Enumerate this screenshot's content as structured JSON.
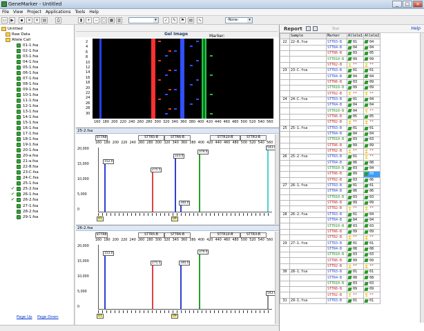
{
  "window": {
    "title": "GeneMarker - Untitled"
  },
  "menu": [
    "File",
    "View",
    "Project",
    "Applications",
    "Tools",
    "Help"
  ],
  "toolbar": {
    "marker_label": "Marker:",
    "marker_value": "-None-"
  },
  "tree": {
    "root": "Untitled",
    "raw": "Raw Data",
    "call": "Allele Call",
    "files": [
      "01-1.fsa",
      "02-1.fsa",
      "03-1.fsa",
      "04-1.fsa",
      "05-1.fsa",
      "06-1.fsa",
      "07-1.fsa",
      "08-1.fsa",
      "09-1.fsa",
      "10-1.fsa",
      "11-1.fsa",
      "12-1.fsa",
      "13-1.fsa",
      "14-1.fsa",
      "15-1.fsa",
      "16-1.fsa",
      "17-1.fsa",
      "18-1.fsa",
      "19-1.fsa",
      "20-1.fsa",
      "20-a.fsa",
      "21-a.fsa",
      "22-8.fsa",
      "23-C.fsa",
      "24-C.fsa",
      "25-1.fsa",
      "25-2.fsa",
      "26-1.fsa",
      "26-2.fsa",
      "27-1.fsa",
      "28-2.fsa",
      "29-1.fsa"
    ],
    "checked": [
      "25-2.fsa",
      "26-1.fsa",
      "26-2.fsa"
    ]
  },
  "left_footer": {
    "page_up": "Page Up",
    "page_down": "Page Down"
  },
  "gel": {
    "title": "Gel Image",
    "y_ticks": [
      "2",
      "4",
      "6",
      "8",
      "10",
      "12",
      "14",
      "16",
      "18",
      "20",
      "22",
      "24",
      "26",
      "28",
      "30"
    ],
    "x_ticks": [
      "160",
      "180",
      "200",
      "220",
      "240",
      "260",
      "280",
      "300",
      "320",
      "340",
      "360",
      "380",
      "400",
      "420",
      "440",
      "460",
      "480",
      "500",
      "520",
      "540",
      "560"
    ]
  },
  "panel1": {
    "name": "25-2.fsa",
    "loci": [
      "STTR8",
      "STTR5-B",
      "STTR6-B",
      "STTR10-B",
      "STTR3-B"
    ],
    "x_ticks": [
      "160",
      "180",
      "200",
      "220",
      "240",
      "260",
      "280",
      "300",
      "320",
      "340",
      "360",
      "380",
      "400",
      "420",
      "440",
      "460",
      "480",
      "500",
      "520",
      "540",
      "560"
    ],
    "y_ticks": [
      "20,000",
      "15,000",
      "10,000",
      "5,000",
      "0"
    ],
    "peaks": [
      "152.0",
      "275.5",
      "333.0",
      "340.0",
      "379.0",
      "543.0"
    ],
    "markers": [
      "01",
      "09"
    ]
  },
  "panel2": {
    "name": "26-2.fsa",
    "loci": [
      "STTR8",
      "STTR5-B",
      "STTR6-B",
      "STTR10-B",
      "STTR3-B"
    ],
    "x_ticks": [
      "160",
      "180",
      "200",
      "220",
      "240",
      "260",
      "280",
      "300",
      "320",
      "340",
      "360",
      "380",
      "400",
      "420",
      "440",
      "460",
      "480",
      "500",
      "520",
      "540",
      "560"
    ],
    "y_ticks": [
      "20,000",
      "15,000",
      "10,000",
      "5,000",
      "0"
    ],
    "peaks": [
      "153.0",
      "275.5",
      "340.0",
      "379.0",
      "543.0"
    ],
    "markers": [
      "01",
      "09"
    ]
  },
  "report": {
    "title": "Report",
    "filter_label": "Stat",
    "help": "Help",
    "columns": [
      "",
      "Sample",
      "Marker",
      "Allele1",
      "Allele2"
    ],
    "rows": [
      [
        "22",
        "22-8.fsa",
        "STTR3-B",
        "01",
        "04"
      ],
      [
        "",
        "",
        "STTR4-B",
        "04",
        "04"
      ],
      [
        "",
        "",
        "STTR6-B",
        "03",
        "05"
      ],
      [
        "",
        "",
        "STTR10-B",
        "09",
        "09"
      ],
      [
        "",
        "",
        "STTR2-B",
        "**",
        "**"
      ],
      [
        "23",
        "23-C.fsa",
        "STTR3-B",
        "01",
        "01"
      ],
      [
        "",
        "",
        "STTR4-B",
        "04",
        "04"
      ],
      [
        "",
        "",
        "STTR6-B",
        "03",
        "09"
      ],
      [
        "",
        "",
        "STTR10-B",
        "09",
        "09"
      ],
      [
        "",
        "",
        "STTR2-B",
        "**",
        "**"
      ],
      [
        "24",
        "24-C.fsa",
        "STTR3-B",
        "01",
        "04"
      ],
      [
        "",
        "",
        "STTR4-B",
        "04",
        "04"
      ],
      [
        "",
        "",
        "STTR10-B",
        "04",
        "**"
      ],
      [
        "",
        "",
        "STTR6-B",
        "05",
        "05"
      ],
      [
        "",
        "",
        "STTR2-B",
        "**",
        "**"
      ],
      [
        "25",
        "25-1.fsa",
        "STTR3-B",
        "01",
        "01"
      ],
      [
        "",
        "",
        "STTR4-B",
        "04",
        "04"
      ],
      [
        "",
        "",
        "STTR10-B",
        "03",
        "03"
      ],
      [
        "",
        "",
        "STTR6-B",
        "09",
        "09"
      ],
      [
        "",
        "",
        "STTR2-B",
        "**",
        "**"
      ],
      [
        "26",
        "25-2.fsa",
        "STTR3-B",
        "01",
        "**"
      ],
      [
        "",
        "",
        "STTR4-B",
        "06",
        "08"
      ],
      [
        "",
        "",
        "STTR10-B",
        "03",
        "04"
      ],
      [
        "",
        "",
        "STTR6-B",
        "09",
        "09"
      ],
      [
        "",
        "",
        "STTR2-B",
        "03",
        "06"
      ],
      [
        "27",
        "26-1.fsa",
        "STTR3-B",
        "01",
        "01"
      ],
      [
        "",
        "",
        "STTR4-B",
        "06",
        "06"
      ],
      [
        "",
        "",
        "STTR10-B",
        "03",
        "03"
      ],
      [
        "",
        "",
        "STTR6-B",
        "09",
        "09"
      ],
      [
        "",
        "",
        "STTR2-B",
        "**",
        "**"
      ],
      [
        "28",
        "26-2.fsa",
        "STTR3-B",
        "01",
        "04"
      ],
      [
        "",
        "",
        "STTR4-B",
        "04",
        "04"
      ],
      [
        "",
        "",
        "STTR10-B",
        "03",
        "03"
      ],
      [
        "",
        "",
        "STTR6-B",
        "09",
        "09"
      ],
      [
        "",
        "",
        "STTR2-B",
        "**",
        "**"
      ],
      [
        "29",
        "27-1.fsa",
        "STTR3-B",
        "01",
        "01"
      ],
      [
        "",
        "",
        "STTR4-B",
        "08",
        "08"
      ],
      [
        "",
        "",
        "STTR10-B",
        "03",
        "03"
      ],
      [
        "",
        "",
        "STTR6-B",
        "09",
        "09"
      ],
      [
        "",
        "",
        "STTR2-B",
        "**",
        "**"
      ],
      [
        "30",
        "28-1.fsa",
        "STTR3-B",
        "01",
        "01"
      ],
      [
        "",
        "",
        "STTR4-B",
        "08",
        "08"
      ],
      [
        "",
        "",
        "STTR10-B",
        "03",
        "03"
      ],
      [
        "",
        "",
        "STTR6-B",
        "09",
        "09"
      ],
      [
        "",
        "",
        "STTR2-B",
        "**",
        "**"
      ],
      [
        "31",
        "29-1.fsa",
        "STTR3-B",
        "01",
        "01"
      ]
    ]
  }
}
